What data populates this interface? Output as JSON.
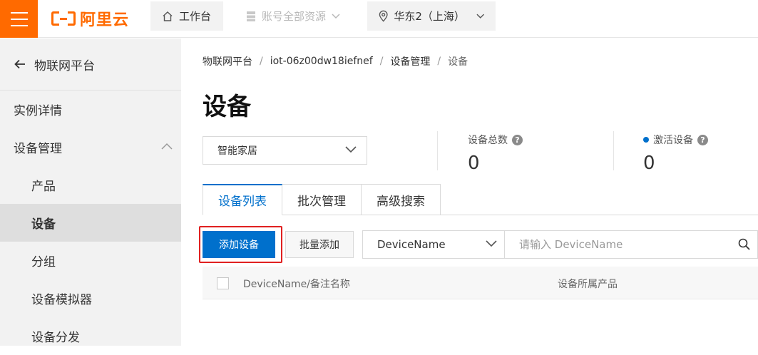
{
  "topbar": {
    "logo_text": "阿里云",
    "workbench_label": "工作台",
    "resources_label": "账号全部资源",
    "region_label": "华东2（上海）",
    "brand_color": "#ff6a00"
  },
  "sidebar": {
    "back_label": "物联网平台",
    "items": [
      {
        "label": "实例详情"
      },
      {
        "label": "设备管理"
      },
      {
        "label": "产品"
      },
      {
        "label": "设备"
      },
      {
        "label": "分组"
      },
      {
        "label": "设备模拟器"
      },
      {
        "label": "设备分发"
      }
    ],
    "active_item": "设备"
  },
  "breadcrumb": {
    "items": [
      "物联网平台",
      "iot-06z00dw18iefnef",
      "设备管理",
      "设备"
    ],
    "separator": "/"
  },
  "page": {
    "title": "设备",
    "product_select": "智能家居",
    "stats": {
      "total_label": "设备总数",
      "total_value": "0",
      "active_label": "激活设备",
      "active_value": "0"
    }
  },
  "tabs": [
    {
      "label": "设备列表",
      "active": true
    },
    {
      "label": "批次管理",
      "active": false
    },
    {
      "label": "高级搜索",
      "active": false
    }
  ],
  "toolbar": {
    "add_label": "添加设备",
    "batch_add_label": "批量添加",
    "search_field": "DeviceName",
    "search_placeholder": "请输入 DeviceName"
  },
  "table": {
    "columns": [
      "DeviceName/备注名称",
      "设备所属产品"
    ]
  },
  "colors": {
    "accent": "#0070cc",
    "highlight_box": "#e02020"
  }
}
